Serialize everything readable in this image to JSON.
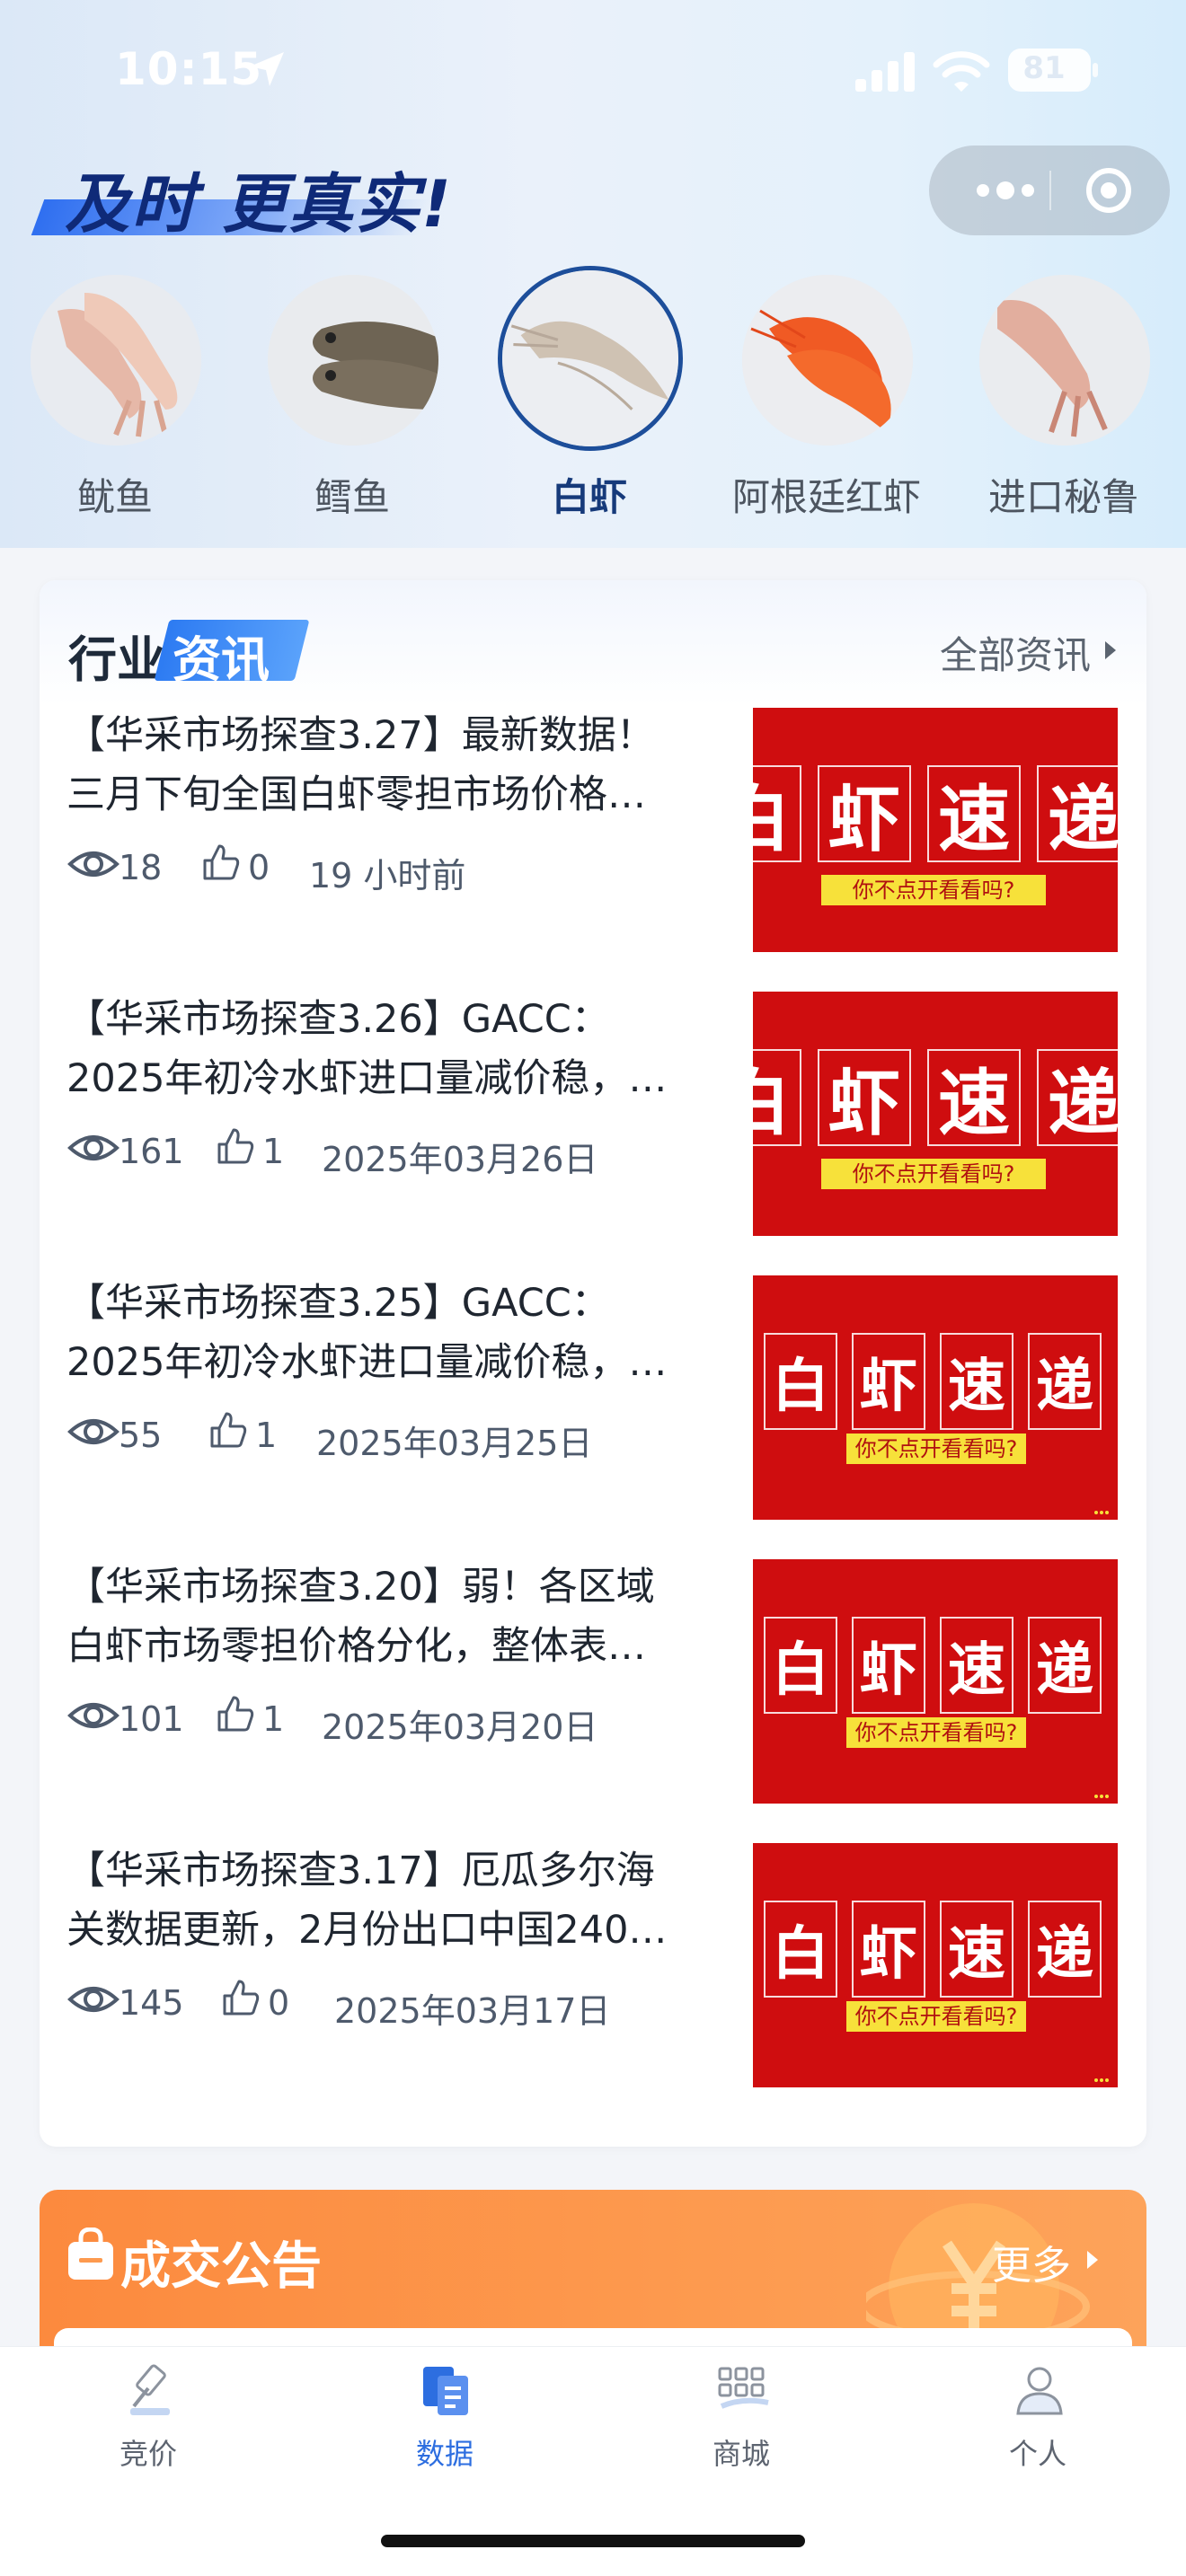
{
  "status_bar": {
    "time": "10:15",
    "battery": "81"
  },
  "header": {
    "slogan": "及时 更真实!"
  },
  "categories": [
    {
      "label": "鱿鱼",
      "active": false
    },
    {
      "label": "鳕鱼",
      "active": false
    },
    {
      "label": "白虾",
      "active": true
    },
    {
      "label": "阿根廷红虾",
      "active": false
    },
    {
      "label": "进口秘鲁",
      "active": false
    }
  ],
  "news": {
    "title_part1": "行业",
    "title_part2": "资讯",
    "all_link": "全部资讯",
    "items": [
      {
        "line1": "【华采市场探查3.27】最新数据！",
        "line2": "三月下旬全国白虾零担市场价格…",
        "views": "18",
        "likes": "0",
        "date": "19 小时前",
        "thumb_chars": [
          "白",
          "虾",
          "速",
          "递"
        ],
        "thumb_sub": "你不点开看看吗?"
      },
      {
        "line1": "【华采市场探查3.26】GACC：",
        "line2": "2025年初冷水虾进口量减价稳，…",
        "views": "161",
        "likes": "1",
        "date": "2025年03月26日",
        "thumb_chars": [
          "白",
          "虾",
          "速",
          "递"
        ],
        "thumb_sub": "你不点开看看吗?"
      },
      {
        "line1": "【华采市场探查3.25】GACC：",
        "line2": "2025年初冷水虾进口量减价稳，…",
        "views": "55",
        "likes": "1",
        "date": "2025年03月25日",
        "thumb_chars": [
          "白",
          "虾",
          "速",
          "递"
        ],
        "thumb_sub": "你不点开看看吗?"
      },
      {
        "line1": "【华采市场探查3.20】弱！各区域",
        "line2": "白虾市场零担价格分化，整体表…",
        "views": "101",
        "likes": "1",
        "date": "2025年03月20日",
        "thumb_chars": [
          "白",
          "虾",
          "速",
          "递"
        ],
        "thumb_sub": "你不点开看看吗?"
      },
      {
        "line1": "【华采市场探查3.17】厄瓜多尔海",
        "line2": "关数据更新，2月份出口中国240…",
        "views": "145",
        "likes": "0",
        "date": "2025年03月17日",
        "thumb_chars": [
          "白",
          "虾",
          "速",
          "递"
        ],
        "thumb_sub": "你不点开看看吗?"
      }
    ]
  },
  "deal": {
    "title": "成交公告",
    "more": "更多"
  },
  "tab_bar": [
    {
      "label": "竞价",
      "icon": "auction-gavel-icon",
      "active": false
    },
    {
      "label": "数据",
      "icon": "data-document-icon",
      "active": true
    },
    {
      "label": "商城",
      "icon": "mall-grid-icon",
      "active": false
    },
    {
      "label": "个人",
      "icon": "profile-person-icon",
      "active": false
    }
  ],
  "colors": {
    "brand_blue": "#2d6ee0",
    "slogan_navy": "#0f2a78",
    "thumb_red": "#cf0d0f",
    "deal_orange": "#fc8a3e"
  }
}
